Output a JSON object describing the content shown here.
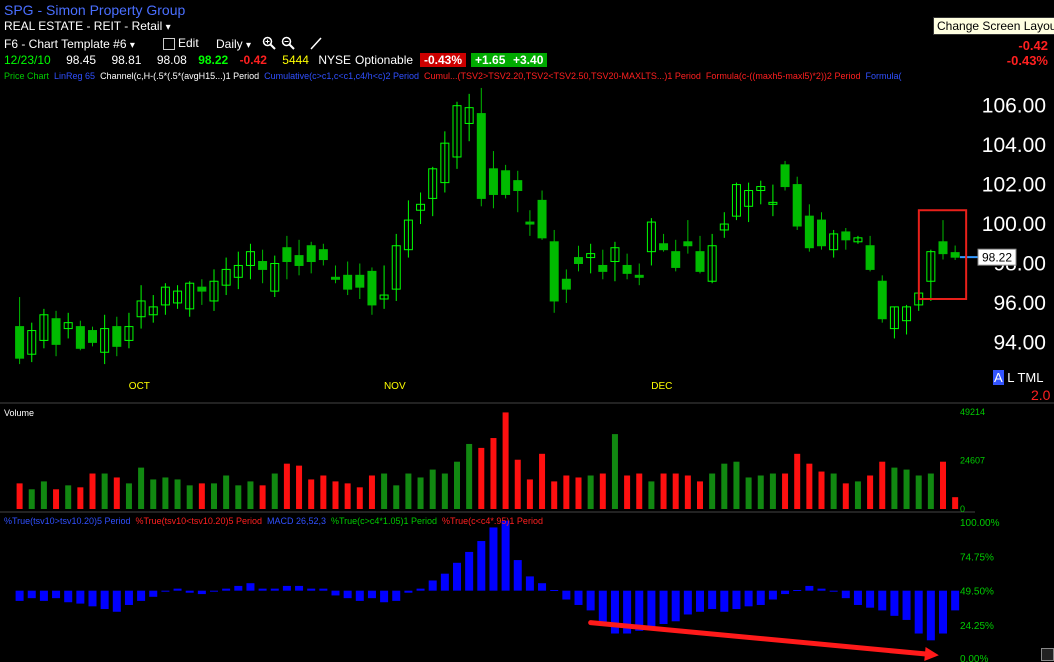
{
  "header": {
    "symbol_title": "SPG - Simon Property Group",
    "sector": "REAL ESTATE - REIT - Retail",
    "sector_arrow": "▾",
    "template": "F6 - Chart Template #6",
    "template_arrow": "▾",
    "edit_label": "Edit",
    "period": "Daily",
    "period_arrow": "▾",
    "tooltip": "Change Screen Layout"
  },
  "quote": {
    "date": "12/23/10",
    "open": "98.45",
    "high": "98.81",
    "low": "98.08",
    "last": "98.22",
    "change": "-0.42",
    "volume": "5444",
    "exchange": "NYSE",
    "optionable": "Optionable",
    "pct_badge": "-0.43%",
    "badge2": "+1.65",
    "badge3": "+3.40",
    "right_change": "-0.42",
    "right_pct": "-0.43%"
  },
  "indicator_legend": [
    {
      "text": "Price Chart",
      "color": "#00cc00"
    },
    {
      "text": "LinReg 65",
      "color": "#3050ff"
    },
    {
      "text": "Channel(c,H-(.5*(.5*(avgH15...)1 Period",
      "color": "#ffffff"
    },
    {
      "text": "Cumulative(c>c1,c<c1,c4/h<c)2 Period",
      "color": "#3050ff"
    },
    {
      "text": "Cumul...(TSV2>TSV2.20,TSV2<TSV2.50,TSV20-MAXLTS...)1 Period",
      "color": "#ff2020"
    },
    {
      "text": "Formula(c-((maxh5-maxl5)*2))2 Period",
      "color": "#ff2020"
    },
    {
      "text": "Formula(",
      "color": "#3050ff"
    }
  ],
  "volume_label": "Volume",
  "oscillator_legend": [
    {
      "text": "%True(tsv10>tsv10.20)5 Period",
      "color": "#3050ff"
    },
    {
      "text": "%True(tsv10<tsv10.20)5 Period",
      "color": "#ff2020"
    },
    {
      "text": "MACD 26,52,3",
      "color": "#3050ff"
    },
    {
      "text": "%True(c>c4*1.05)1 Period",
      "color": "#00cc00"
    },
    {
      "text": "%True(c<c4*.95)1 Period",
      "color": "#ff2020"
    }
  ],
  "badges": {
    "a": "A",
    "l": "L",
    "tml": "TML",
    "ratio": "2.0"
  },
  "colors": {
    "up": "#00ff00",
    "down": "#00bb00",
    "vol_up": "#118811",
    "vol_down": "#ff1010",
    "osc": "#0000ff",
    "highlight": "#e8201a",
    "arrow": "#ff1a1a",
    "axis_text": "#ffffff",
    "vol_axis": "#00cc00",
    "current": "#3399ff"
  },
  "chart_data": {
    "type": "candlestick",
    "title": "SPG - Simon Property Group",
    "price_ylim": [
      92.5,
      107
    ],
    "price_ticks": [
      "94.00",
      "96.00",
      "98.00",
      "100.00",
      "102.00",
      "104.00",
      "106.00"
    ],
    "price_tick_values": [
      94,
      96,
      98,
      100,
      102,
      104,
      106
    ],
    "current_price": "98.22",
    "current_value": 98.22,
    "month_labels": [
      {
        "label": "OCT",
        "index": 8
      },
      {
        "label": "NOV",
        "index": 29
      },
      {
        "label": "DEC",
        "index": 51
      }
    ],
    "candles": [
      [
        94.7,
        96.2,
        92.8,
        93.1
      ],
      [
        93.3,
        94.9,
        92.9,
        94.5
      ],
      [
        94.0,
        95.6,
        93.6,
        95.3
      ],
      [
        95.1,
        95.5,
        93.2,
        93.8
      ],
      [
        94.6,
        95.4,
        94.1,
        94.9
      ],
      [
        94.7,
        95.0,
        93.5,
        93.6
      ],
      [
        94.5,
        94.7,
        93.7,
        93.9
      ],
      [
        93.4,
        95.3,
        92.8,
        94.6
      ],
      [
        94.7,
        95.2,
        93.2,
        93.7
      ],
      [
        94.0,
        95.4,
        93.6,
        94.7
      ],
      [
        95.2,
        96.8,
        94.6,
        96.0
      ],
      [
        95.3,
        96.3,
        94.9,
        95.7
      ],
      [
        95.8,
        96.9,
        95.3,
        96.7
      ],
      [
        95.9,
        96.8,
        95.6,
        96.5
      ],
      [
        95.6,
        97.0,
        95.2,
        96.9
      ],
      [
        96.7,
        97.1,
        95.8,
        96.5
      ],
      [
        96.0,
        97.6,
        95.5,
        97.0
      ],
      [
        96.8,
        98.2,
        96.3,
        97.6
      ],
      [
        97.2,
        98.5,
        96.6,
        97.8
      ],
      [
        97.8,
        98.9,
        97.1,
        98.5
      ],
      [
        98.0,
        98.6,
        96.9,
        97.6
      ],
      [
        96.5,
        98.3,
        96.2,
        97.9
      ],
      [
        98.7,
        99.3,
        97.1,
        98.0
      ],
      [
        98.3,
        99.1,
        97.3,
        97.8
      ],
      [
        98.8,
        99.0,
        97.4,
        98.0
      ],
      [
        98.6,
        98.9,
        97.8,
        98.1
      ],
      [
        97.2,
        97.8,
        96.9,
        97.1
      ],
      [
        97.3,
        98.0,
        96.3,
        96.6
      ],
      [
        97.3,
        97.9,
        96.1,
        96.7
      ],
      [
        97.5,
        97.7,
        95.3,
        95.8
      ],
      [
        96.1,
        97.8,
        95.6,
        96.3
      ],
      [
        96.6,
        99.4,
        96.0,
        98.8
      ],
      [
        98.6,
        101.1,
        98.2,
        100.1
      ],
      [
        100.6,
        101.5,
        99.9,
        100.9
      ],
      [
        101.2,
        102.8,
        100.3,
        102.7
      ],
      [
        102.0,
        104.6,
        101.5,
        104.0
      ],
      [
        103.3,
        106.1,
        102.7,
        105.9
      ],
      [
        105.0,
        106.5,
        104.1,
        105.8
      ],
      [
        105.5,
        106.8,
        100.8,
        101.2
      ],
      [
        102.7,
        103.6,
        100.7,
        101.4
      ],
      [
        102.6,
        102.9,
        101.2,
        101.4
      ],
      [
        102.1,
        102.6,
        100.5,
        101.6
      ],
      [
        100.0,
        100.6,
        99.3,
        99.9
      ],
      [
        101.1,
        101.6,
        99.1,
        99.2
      ],
      [
        99.0,
        99.6,
        95.4,
        96.0
      ],
      [
        97.1,
        97.6,
        95.9,
        96.6
      ],
      [
        98.2,
        98.8,
        97.5,
        97.9
      ],
      [
        98.2,
        98.9,
        97.4,
        98.4
      ],
      [
        97.8,
        98.6,
        97.1,
        97.5
      ],
      [
        98.0,
        99.0,
        97.0,
        98.7
      ],
      [
        97.8,
        98.4,
        97.1,
        97.4
      ],
      [
        97.3,
        97.9,
        96.8,
        97.2
      ],
      [
        98.5,
        100.2,
        97.8,
        100.0
      ],
      [
        98.9,
        99.4,
        98.5,
        98.6
      ],
      [
        98.5,
        99.1,
        97.5,
        97.7
      ],
      [
        99.0,
        100.1,
        98.4,
        98.8
      ],
      [
        98.5,
        99.3,
        97.4,
        97.5
      ],
      [
        97.0,
        99.4,
        96.9,
        98.8
      ],
      [
        99.6,
        100.5,
        99.2,
        99.9
      ],
      [
        100.3,
        102.0,
        100.1,
        101.9
      ],
      [
        100.8,
        102.0,
        100.0,
        101.6
      ],
      [
        101.6,
        102.1,
        100.9,
        101.8
      ],
      [
        100.9,
        101.9,
        100.3,
        101.0
      ],
      [
        102.9,
        103.1,
        101.6,
        101.8
      ],
      [
        101.9,
        102.3,
        99.6,
        99.8
      ],
      [
        100.3,
        100.9,
        98.5,
        98.7
      ],
      [
        100.1,
        100.5,
        98.6,
        98.8
      ],
      [
        98.6,
        99.6,
        98.2,
        99.4
      ],
      [
        99.5,
        99.7,
        98.6,
        99.1
      ],
      [
        99.0,
        99.3,
        98.9,
        99.2
      ],
      [
        98.8,
        99.3,
        97.5,
        97.6
      ],
      [
        97.0,
        97.3,
        94.9,
        95.1
      ],
      [
        94.6,
        95.7,
        94.1,
        95.7
      ],
      [
        95.0,
        95.8,
        94.3,
        95.7
      ],
      [
        95.8,
        97.2,
        95.5,
        96.4
      ],
      [
        97.0,
        98.6,
        96.0,
        98.5
      ],
      [
        99.0,
        100.1,
        98.1,
        98.4
      ],
      [
        98.45,
        98.81,
        98.08,
        98.22
      ]
    ],
    "volume_ticks": [
      "0",
      "24607",
      "49214"
    ],
    "volume_tick_values": [
      0,
      24607,
      49214
    ],
    "volume_max": 49214,
    "volume": [
      13000,
      10000,
      14000,
      10000,
      12000,
      11000,
      18000,
      18000,
      16000,
      13000,
      21000,
      15000,
      16000,
      15000,
      12000,
      13000,
      13000,
      17000,
      12000,
      14000,
      12000,
      18000,
      23000,
      22000,
      15000,
      17000,
      14000,
      13000,
      11000,
      17000,
      18000,
      12000,
      18000,
      16000,
      20000,
      18000,
      24000,
      33000,
      31000,
      36000,
      49000,
      25000,
      15000,
      28000,
      14000,
      17000,
      16000,
      17000,
      18000,
      38000,
      17000,
      18000,
      14000,
      18000,
      18000,
      17000,
      14000,
      18000,
      23000,
      24000,
      16000,
      17000,
      18000,
      18000,
      28000,
      23000,
      19000,
      18000,
      13000,
      14000,
      17000,
      24000,
      21000,
      20000,
      17000,
      18000,
      24000,
      6000
    ],
    "osc_ticks": [
      "0.00%",
      "24.25%",
      "49.50%",
      "74.75%",
      "100.00%"
    ],
    "osc_tick_values": [
      0,
      24.25,
      49.5,
      74.75,
      100
    ],
    "osc_baseline": 49.5,
    "oscillator": [
      42,
      44,
      42,
      44,
      41,
      40,
      38,
      36,
      34,
      39,
      42,
      45,
      49,
      51,
      48,
      47,
      49,
      51,
      53,
      55,
      51,
      51,
      53,
      53,
      51,
      51,
      46,
      44,
      42,
      44,
      41,
      42,
      48,
      51,
      57,
      62,
      70,
      78,
      86,
      96,
      101,
      72,
      60,
      55,
      50,
      43,
      39,
      35,
      24,
      18,
      18,
      20,
      23,
      25,
      27,
      32,
      34,
      36,
      34,
      36,
      38,
      39,
      43,
      47,
      50,
      53,
      51,
      49,
      44,
      39,
      37,
      35,
      31,
      28,
      18,
      13,
      18,
      35
    ],
    "osc_indices_offset": 0,
    "highlight_box_index": [
      75,
      77
    ],
    "trend_arrow": {
      "from_index": 47,
      "from_value": 26,
      "to_index": 75,
      "to_value": 2
    }
  }
}
